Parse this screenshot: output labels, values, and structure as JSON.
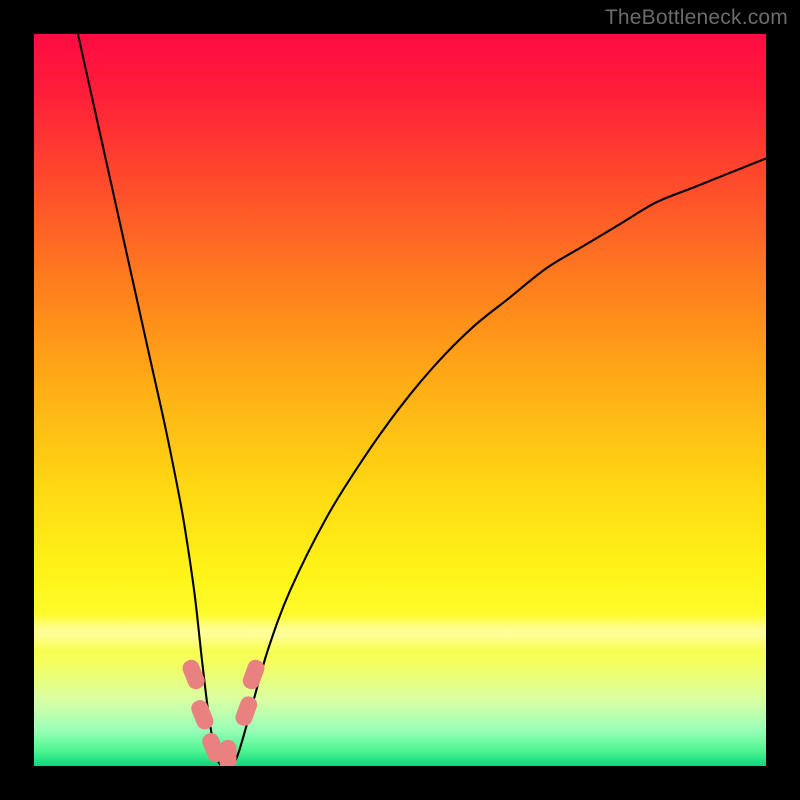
{
  "watermark": "TheBottleneck.com",
  "chart_data": {
    "type": "line",
    "title": "",
    "xlabel": "",
    "ylabel": "",
    "xlim": [
      0,
      100
    ],
    "ylim": [
      0,
      100
    ],
    "grid": false,
    "background": "rainbow-vertical-gradient",
    "series": [
      {
        "name": "bottleneck-curve",
        "x": [
          6,
          8,
          10,
          12,
          14,
          16,
          18,
          20,
          21,
          22,
          23,
          24,
          25,
          26,
          27,
          28,
          30,
          32,
          35,
          40,
          45,
          50,
          55,
          60,
          65,
          70,
          75,
          80,
          85,
          90,
          95,
          100
        ],
        "y": [
          100,
          91,
          82,
          73,
          64,
          55,
          46,
          36,
          30,
          23,
          14,
          6,
          1,
          0,
          0,
          2,
          9,
          16,
          24,
          34,
          42,
          49,
          55,
          60,
          64,
          68,
          71,
          74,
          77,
          79,
          81,
          83
        ]
      }
    ],
    "markers": [
      {
        "x": 21.8,
        "y": 12.5
      },
      {
        "x": 23.0,
        "y": 7.0
      },
      {
        "x": 24.5,
        "y": 2.5
      },
      {
        "x": 26.5,
        "y": 1.5
      },
      {
        "x": 29.0,
        "y": 7.5
      },
      {
        "x": 30.0,
        "y": 12.5
      }
    ],
    "optimum_x": 26
  }
}
